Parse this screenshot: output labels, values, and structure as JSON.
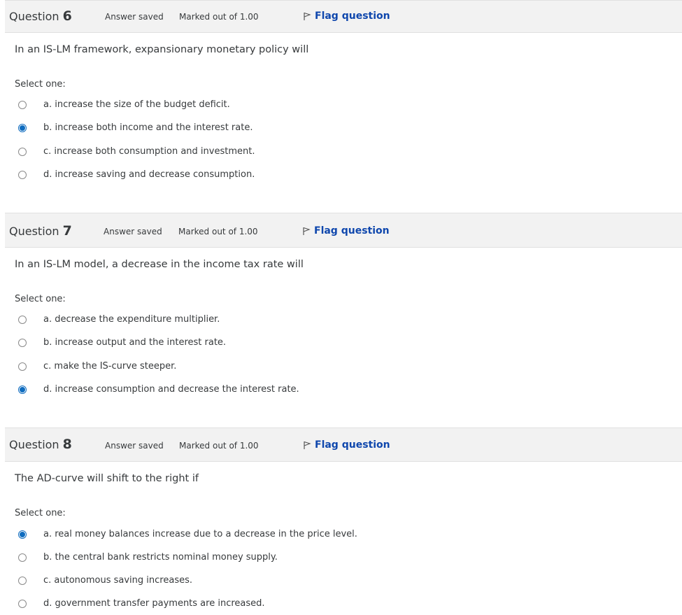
{
  "questions": [
    {
      "label": "Question",
      "number": "6",
      "state": "Answer saved",
      "grade": "Marked out of 1.00",
      "flag": "Flag question",
      "text": "In an IS-LM framework, expansionary monetary policy will",
      "prompt": "Select one:",
      "answers": [
        {
          "label": "a. increase the size of the budget deficit.",
          "checked": false
        },
        {
          "label": "b. increase both income and the interest rate.",
          "checked": true
        },
        {
          "label": "c. increase both consumption and investment.",
          "checked": false
        },
        {
          "label": "d. increase saving and decrease consumption.",
          "checked": false
        }
      ]
    },
    {
      "label": "Question",
      "number": "7",
      "state": "Answer saved",
      "grade": "Marked out of 1.00",
      "flag": "Flag question",
      "text": "In an IS-LM model, a decrease in the income tax rate will",
      "prompt": "Select one:",
      "answers": [
        {
          "label": "a. decrease the expenditure multiplier.",
          "checked": false
        },
        {
          "label": "b. increase output and the interest rate.",
          "checked": false
        },
        {
          "label": "c. make the IS-curve steeper.",
          "checked": false
        },
        {
          "label": "d. increase consumption and decrease the interest rate.",
          "checked": true
        }
      ]
    },
    {
      "label": "Question",
      "number": "8",
      "state": "Answer saved",
      "grade": "Marked out of 1.00",
      "flag": "Flag question",
      "text": "The AD-curve will shift to the right if",
      "prompt": "Select one:",
      "answers": [
        {
          "label": "a. real money balances increase due to a decrease in the price level.",
          "checked": true
        },
        {
          "label": "b. the central bank restricts nominal money supply.",
          "checked": false
        },
        {
          "label": "c. autonomous saving increases.",
          "checked": false
        },
        {
          "label": "d. government transfer payments are increased.",
          "checked": false
        }
      ]
    }
  ],
  "icons": {
    "flag": "flag-icon",
    "radio": "radio-button"
  },
  "colors": {
    "header_bg": "#f2f2f2",
    "flag_link": "#0f47ad",
    "radio_checked": "#0f6cbf",
    "text": "#373a3c"
  }
}
